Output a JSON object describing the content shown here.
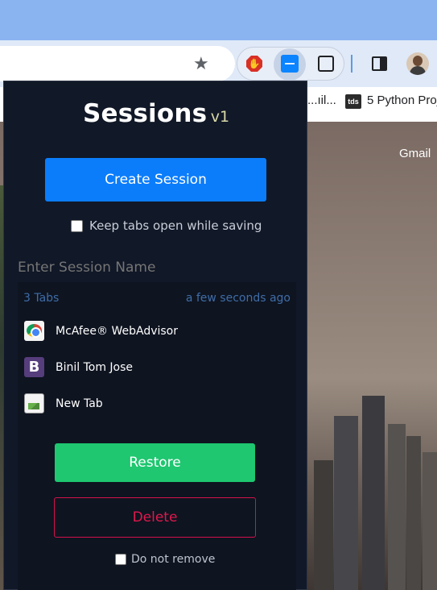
{
  "browser": {
    "bookmark_partial": "...ıil...",
    "bookmark_favicon": "tds",
    "bookmark_label": "5 Python Proj",
    "page_link": "Gmail"
  },
  "popup": {
    "title": "Sessions",
    "version": "v1",
    "create_button": "Create Session",
    "keep_tabs_label": "Keep tabs open while saving",
    "keep_tabs_checked": false,
    "session_name_placeholder": "Enter Session Name",
    "session": {
      "tab_count": "3 Tabs",
      "saved_time": "a few seconds ago",
      "tabs": [
        {
          "title": "McAfee® WebAdvisor",
          "icon": "mcafee-icon"
        },
        {
          "title": "Binil Tom Jose",
          "icon": "bootstrap-b-icon"
        },
        {
          "title": "New Tab",
          "icon": "broken-image-icon"
        }
      ],
      "restore_button": "Restore",
      "delete_button": "Delete",
      "do_not_remove_label": "Do not remove",
      "do_not_remove_checked": false
    }
  },
  "colors": {
    "popup_bg": "#111827",
    "primary": "#0b7dfb",
    "success": "#1ec770",
    "danger": "#e0184d",
    "muted_blue": "#3f6da8"
  }
}
